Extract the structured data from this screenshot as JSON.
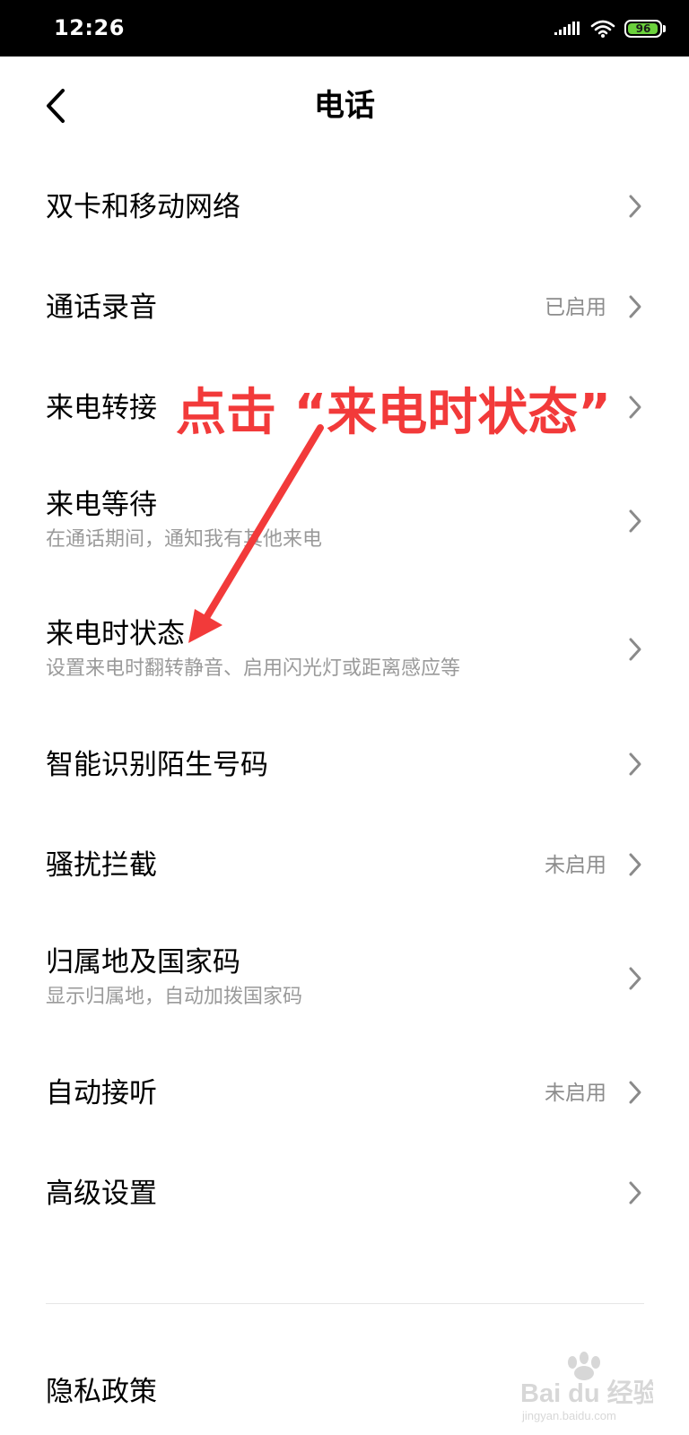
{
  "status_bar": {
    "time": "12:26",
    "battery_level": "96",
    "icons": [
      "signal-icon",
      "wifi-icon",
      "battery-icon"
    ]
  },
  "header": {
    "title": "电话",
    "back_icon": "chevron-left-icon"
  },
  "settings": {
    "dual_sim": {
      "title": "双卡和移动网络"
    },
    "call_recording": {
      "title": "通话录音",
      "value": "已启用"
    },
    "call_forwarding": {
      "title": "来电转接"
    },
    "call_waiting": {
      "title": "来电等待",
      "subtitle": "在通话期间，通知我有其他来电"
    },
    "incoming_call_state": {
      "title": "来电时状态",
      "subtitle": "设置来电时翻转静音、启用闪光灯或距离感应等"
    },
    "unknown_number_id": {
      "title": "智能识别陌生号码"
    },
    "harassment_block": {
      "title": "骚扰拦截",
      "value": "未启用"
    },
    "caller_location": {
      "title": "归属地及国家码",
      "subtitle": "显示归属地，自动加拨国家码"
    },
    "auto_answer": {
      "title": "自动接听",
      "value": "未启用"
    },
    "advanced": {
      "title": "高级设置"
    },
    "privacy_policy": {
      "title": "隐私政策"
    }
  },
  "annotation": {
    "text": "点击 “来电时状态”",
    "color": "#f23a3a"
  },
  "watermark": {
    "brand": "Bai du 经验",
    "url": "jingyan.baidu.com"
  },
  "colors": {
    "status_bar_bg": "#000000",
    "battery_fill": "#6bd13c",
    "secondary_text": "#9a9a9a",
    "chevron": "#8a8a8a"
  }
}
